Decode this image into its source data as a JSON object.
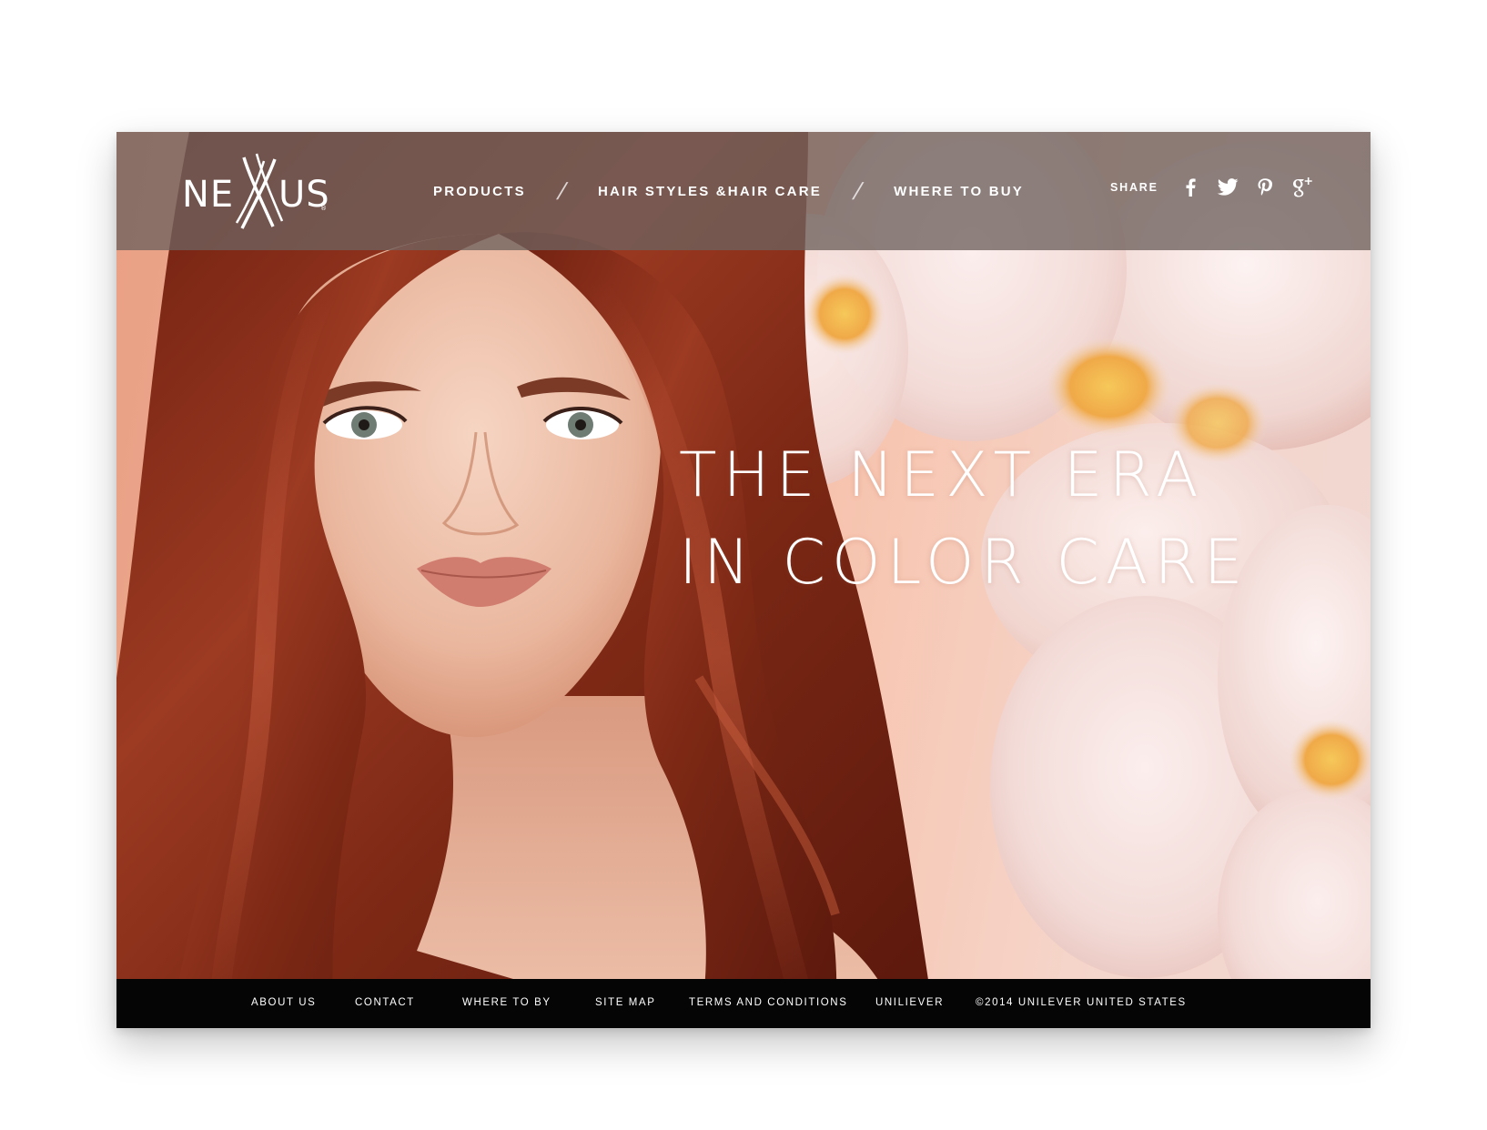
{
  "brand": {
    "logo_text": "NEXXUS"
  },
  "nav": {
    "items": [
      {
        "label": "PRODUCTS"
      },
      {
        "label": "HAIR STYLES &HAIR CARE"
      },
      {
        "label": "WHERE TO BUY"
      }
    ],
    "separator": "/"
  },
  "share": {
    "label": "SHARE",
    "icons": [
      "facebook-icon",
      "twitter-icon",
      "pinterest-icon",
      "google-plus-icon"
    ]
  },
  "hero": {
    "headline_line1": "THE NEXT ERA",
    "headline_line2": "IN COLOR CARE"
  },
  "footer": {
    "links": [
      {
        "label": "ABOUT US"
      },
      {
        "label": "CONTACT"
      },
      {
        "label": "WHERE TO BY"
      },
      {
        "label": "SITE MAP"
      },
      {
        "label": "TERMS AND CONDITIONS"
      },
      {
        "label": "UNILIEVER"
      }
    ],
    "copyright": "©2014 UNILEVER UNITED STATES"
  },
  "colors": {
    "navbar": "#6e625e",
    "footer": "#050505",
    "hair": "#8a2e1a",
    "background": "#f3bda7",
    "text": "#ffffff"
  }
}
